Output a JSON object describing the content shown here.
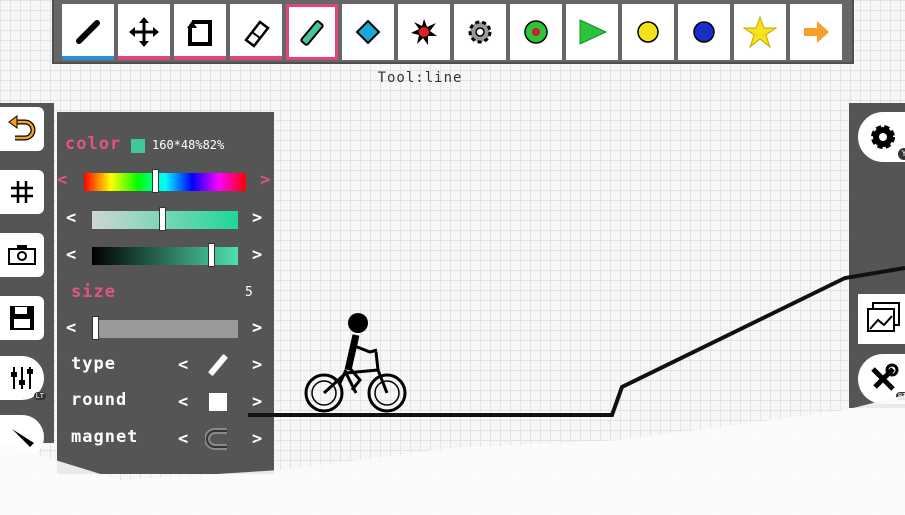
{
  "toolbar": {
    "tools": [
      {
        "name": "pencil-tool",
        "icon": "pencil-icon",
        "underline": "#2a8fd6"
      },
      {
        "name": "move-tool",
        "icon": "move-arrows-icon",
        "underline": "#e0457b"
      },
      {
        "name": "rotate-tool",
        "icon": "rotate-icon",
        "underline": "#e0457b"
      },
      {
        "name": "eraser-tool",
        "icon": "eraser-icon",
        "underline": "#e0457b"
      },
      {
        "name": "line-tool",
        "icon": "line-icon",
        "selected": true
      },
      {
        "name": "boost-tool",
        "icon": "blue-diamond-icon"
      },
      {
        "name": "bomb-tool",
        "icon": "red-burst-icon"
      },
      {
        "name": "gear-object-tool",
        "icon": "grey-gear-icon"
      },
      {
        "name": "checkpoint-tool",
        "icon": "green-dot-icon"
      },
      {
        "name": "start-tool",
        "icon": "green-triangle-icon"
      },
      {
        "name": "yellow-ball-tool",
        "icon": "yellow-circle-icon"
      },
      {
        "name": "blue-ball-tool",
        "icon": "blue-circle-icon"
      },
      {
        "name": "star-tool",
        "icon": "yellow-star-icon"
      },
      {
        "name": "direction-tool",
        "icon": "orange-arrow-icon"
      }
    ]
  },
  "status": {
    "tool_text": "Tool:line"
  },
  "panel": {
    "color_label": "color",
    "color_value": "160*48%82%",
    "swatch": "#40c89a",
    "size_label": "size",
    "size_value": "5",
    "type_label": "type",
    "round_label": "round",
    "magnet_label": "magnet",
    "prev": "<",
    "next": ">"
  },
  "colors": {
    "accent_pink": "#e2538a",
    "panel_bg": "#555555",
    "selected_border": "#e0457b"
  },
  "left_buttons": [
    "undo-icon",
    "grid-icon",
    "camera-icon",
    "save-icon",
    "sliders-icon",
    "pen-icon"
  ],
  "right_buttons": [
    "gear-icon",
    "images-icon",
    "tools-icon"
  ],
  "badges": {
    "sliders": "LT",
    "gear": "Y",
    "tools": "RT"
  }
}
